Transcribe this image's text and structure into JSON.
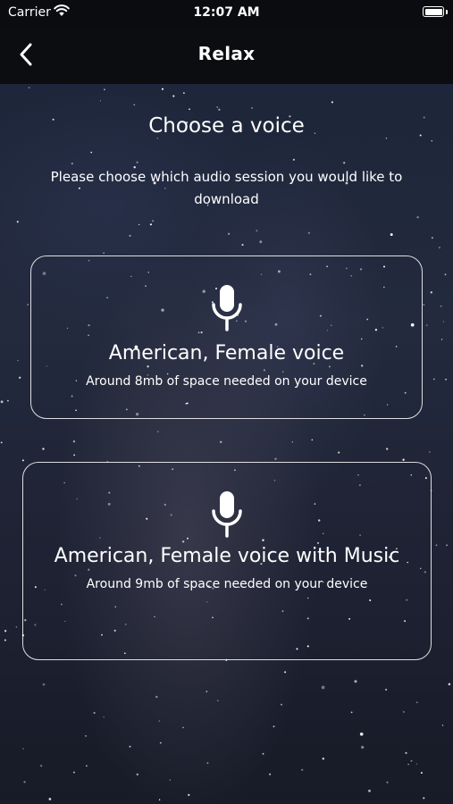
{
  "status_bar": {
    "carrier": "Carrier",
    "time": "12:07 AM",
    "icons": [
      "wifi-icon",
      "battery-icon"
    ]
  },
  "nav": {
    "back_icon": "chevron-left-icon",
    "title": "Relax"
  },
  "main": {
    "heading": "Choose a voice",
    "subtitle": "Please choose which audio session you would like to download"
  },
  "options": [
    {
      "icon": "microphone-icon",
      "title": "American, Female voice",
      "description": "Around 8mb of space needed on your device"
    },
    {
      "icon": "microphone-icon",
      "title": "American, Female voice with Music",
      "description": "Around 9mb of space needed on your device"
    }
  ],
  "colors": {
    "bar_background": "#0b0c10",
    "text": "#ffffff",
    "card_border": "#ffffff"
  }
}
